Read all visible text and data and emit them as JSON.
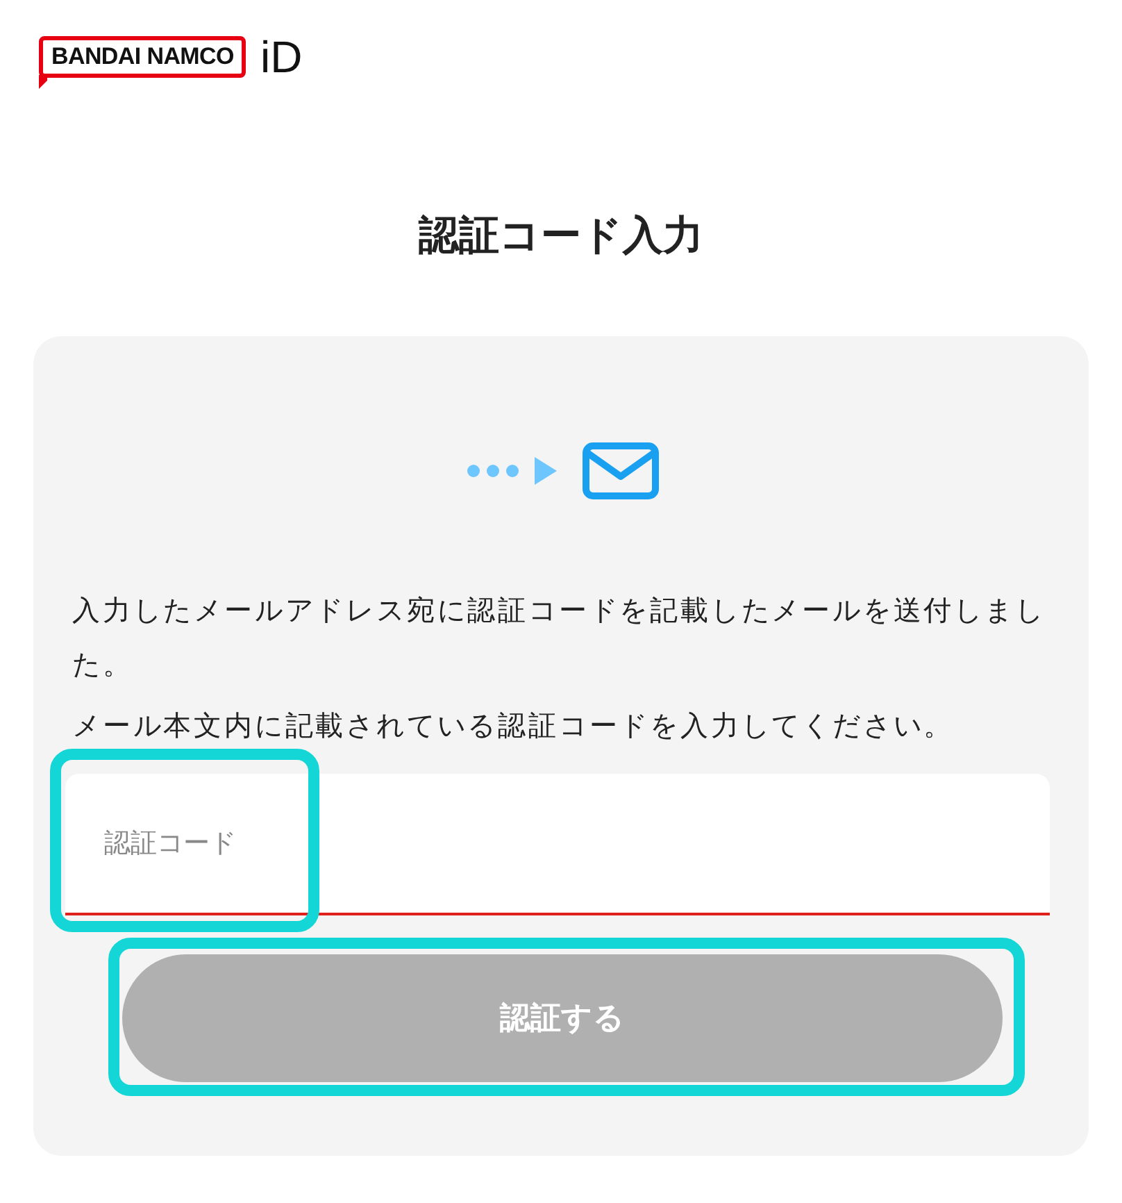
{
  "header": {
    "logo_text": "BANDAI NAMCO",
    "logo_suffix": "iD"
  },
  "title": "認証コード入力",
  "card": {
    "messages": [
      "入力したメールアドレス宛に認証コードを記載したメールを送付しました。",
      "メール本文内に記載されている認証コードを入力してください。"
    ],
    "field": {
      "placeholder": "認証コード",
      "highlighted": true
    },
    "button": {
      "label": "認証する",
      "disabled": true,
      "highlighted": true
    }
  }
}
